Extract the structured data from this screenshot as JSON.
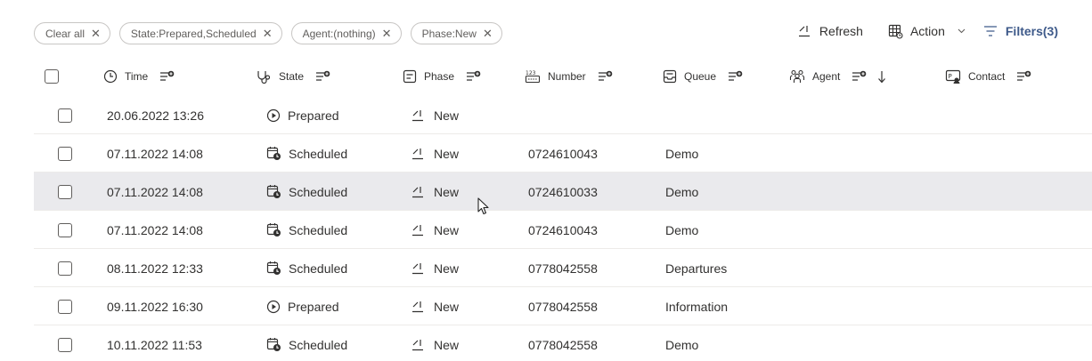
{
  "filters": {
    "chips": [
      {
        "label": "Clear all"
      },
      {
        "label": "State:Prepared,Scheduled"
      },
      {
        "label": "Agent:(nothing)"
      },
      {
        "label": "Phase:New"
      }
    ],
    "remove_glyph": "✕"
  },
  "toolbar": {
    "refresh_label": "Refresh",
    "action_label": "Action",
    "filters_label": "Filters(3)"
  },
  "columns": [
    {
      "key": "time",
      "label": "Time",
      "icon": "clock-icon"
    },
    {
      "key": "state",
      "label": "State",
      "icon": "stethoscope-icon"
    },
    {
      "key": "phase",
      "label": "Phase",
      "icon": "phase-card-icon"
    },
    {
      "key": "number",
      "label": "Number",
      "icon": "number-123-icon"
    },
    {
      "key": "queue",
      "label": "Queue",
      "icon": "queue-tray-icon"
    },
    {
      "key": "agent",
      "label": "Agent",
      "icon": "agents-group-icon"
    },
    {
      "key": "contact",
      "label": "Contact",
      "icon": "contact-card-icon"
    }
  ],
  "sort": {
    "column": "agent",
    "direction": "descending"
  },
  "rows": [
    {
      "time": "20.06.2022 13:26",
      "state": "Prepared",
      "phase": "New",
      "number": "",
      "queue": "",
      "agent": "",
      "contact": ""
    },
    {
      "time": "07.11.2022 14:08",
      "state": "Scheduled",
      "phase": "New",
      "number": "0724610043",
      "queue": "Demo",
      "agent": "",
      "contact": ""
    },
    {
      "time": "07.11.2022 14:08",
      "state": "Scheduled",
      "phase": "New",
      "number": "0724610033",
      "queue": "Demo",
      "agent": "",
      "contact": "",
      "hovered": true
    },
    {
      "time": "07.11.2022 14:08",
      "state": "Scheduled",
      "phase": "New",
      "number": "0724610043",
      "queue": "Demo",
      "agent": "",
      "contact": ""
    },
    {
      "time": "08.11.2022 12:33",
      "state": "Scheduled",
      "phase": "New",
      "number": "0778042558",
      "queue": "Departures",
      "agent": "",
      "contact": ""
    },
    {
      "time": "09.11.2022 16:30",
      "state": "Prepared",
      "phase": "New",
      "number": "0778042558",
      "queue": "Information",
      "agent": "",
      "contact": ""
    },
    {
      "time": "10.11.2022 11:53",
      "state": "Scheduled",
      "phase": "New",
      "number": "0778042558",
      "queue": "Demo",
      "agent": "",
      "contact": ""
    }
  ],
  "colors": {
    "filters_accent": "#3e5a8a",
    "row_hover": "#eaeaed",
    "divider": "#edebe9",
    "text": "#323130"
  }
}
